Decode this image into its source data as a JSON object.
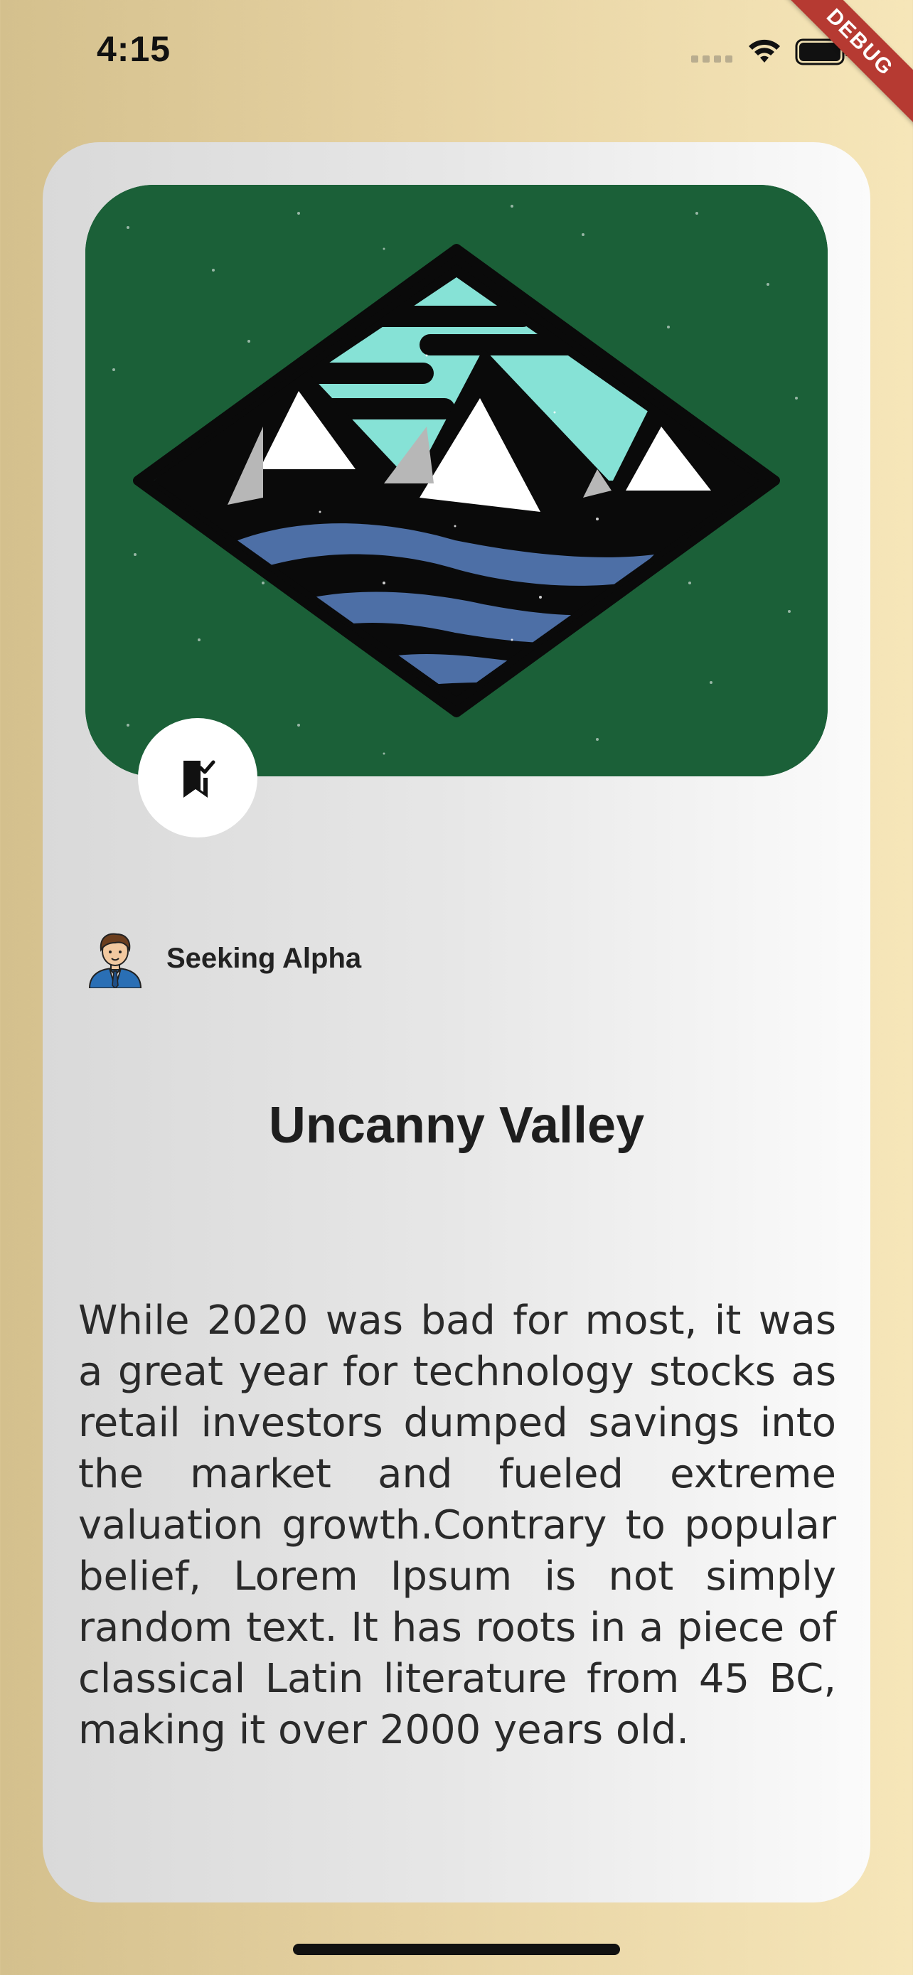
{
  "status_bar": {
    "time": "4:15",
    "icons": [
      "cellular-signal-icon",
      "wifi-icon",
      "battery-icon"
    ]
  },
  "debug_banner": "DEBUG",
  "article": {
    "image_icon": "mountains-lake-illustration",
    "bookmark_icon": "bookmark-check-icon",
    "author": {
      "avatar_icon": "businessman-avatar-icon",
      "name": "Seeking Alpha"
    },
    "title": "Uncanny Valley",
    "body": "While 2020 was bad for most, it was a great year for technology stocks as retail investors dumped savings into the market and fueled extreme valuation growth.Contrary to popular belief, Lorem Ipsum is not simply random text. It has roots in a piece of classical Latin literature from 45 BC, making it over 2000 years old."
  },
  "colors": {
    "background_gradient": [
      "#d4c08d",
      "#f6e6b9"
    ],
    "hero_background": "#1b6038",
    "sky": "#86e2d6",
    "water": "#4d6fa6",
    "debug_ribbon": "#b63a32"
  }
}
